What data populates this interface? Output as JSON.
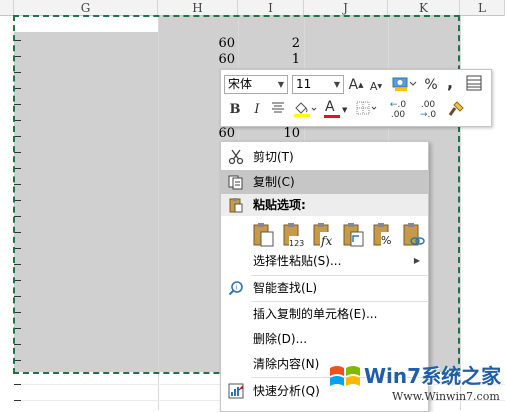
{
  "columns": [
    "G",
    "H",
    "I",
    "J",
    "K",
    "L"
  ],
  "numbers": {
    "h1": "60",
    "i1": "2",
    "h2": "60",
    "i2": "1",
    "h3": "60",
    "i3": "10"
  },
  "mini_toolbar": {
    "font_name": "宋体",
    "font_size": "11",
    "grow_font": "A",
    "shrink_font": "A",
    "percent": "%",
    "comma": ",",
    "bold": "B",
    "italic": "I",
    "font_color_letter": "A",
    "inc_decimal": ".00",
    "dec_decimal": ".0"
  },
  "context_menu": {
    "cut": "剪切(T)",
    "copy": "复制(C)",
    "paste_options": "粘贴选项:",
    "paste_special": "选择性粘贴(S)...",
    "smart_lookup": "智能查找(L)",
    "insert_copied": "插入复制的单元格(E)...",
    "delete": "删除(D)...",
    "clear_contents": "清除内容(N)",
    "quick_analysis": "快速分析(Q)"
  },
  "watermark": {
    "brand": "Win7系统之家",
    "url": "Www.Winwin7.com"
  },
  "colors": {
    "selection_gray": "#d0d0d0",
    "marquee_green": "#217346",
    "font_color_red": "#e81123",
    "highlight_yellow": "#ffff00"
  },
  "icons": [
    "scissors-icon",
    "copy-icon",
    "paste-icon",
    "search-icon",
    "quick-analysis-icon",
    "format-painter-icon"
  ]
}
